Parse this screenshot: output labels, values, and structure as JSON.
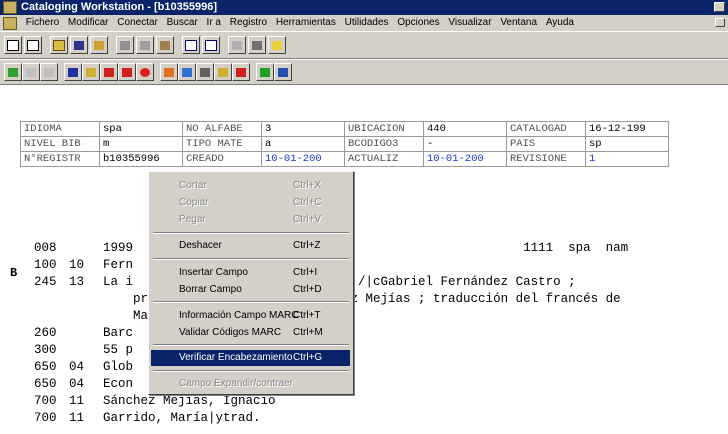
{
  "window": {
    "title": "Cataloging Workstation - [b10355996]",
    "app_icon": "app-icon"
  },
  "menu": [
    "Fichero",
    "Modificar",
    "Conectar",
    "Buscar",
    "Ir a",
    "Registro",
    "Herramientas",
    "Utilidades",
    "Opciones",
    "Visualizar",
    "Ventana",
    "Ayuda"
  ],
  "fixed_fields": {
    "row1": [
      "IDIOMA",
      "spa",
      "NO ALFABE",
      "3",
      "UBICACION",
      "440",
      "CATALOGAD",
      "16-12-199"
    ],
    "row2": [
      "NIVEL BIB",
      "m",
      "TIPO MATE",
      "a",
      "BCODIGO3",
      "-",
      "PAIS",
      "sp"
    ],
    "row3": [
      "N°REGISTR",
      "b10355996",
      "CREADO",
      "10-01-200",
      "ACTUALIZ",
      "10-01-200",
      "REVISIONE",
      "1"
    ]
  },
  "marc_marker": "B",
  "marc": [
    {
      "tag": "008",
      "ind": "",
      "text": "1999                                                    1111  spa  nam"
    },
    {
      "tag": "100",
      "ind": "10",
      "text": "Fern"
    },
    {
      "tag": "245",
      "ind": "13",
      "text": "La i                            l /|cGabriel Fernández Castro ;"
    },
    {
      "tag": "",
      "ind": "",
      "text": "    pról                         z Mejías ; traducción del francés de"
    },
    {
      "tag": "",
      "ind": "",
      "text": "    Marí"
    },
    {
      "tag": "260",
      "ind": "",
      "text": "Barc                       ,|1987"
    },
    {
      "tag": "300",
      "ind": "",
      "text": "55 p"
    },
    {
      "tag": "650",
      "ind": "04",
      "text": "Glob"
    },
    {
      "tag": "650",
      "ind": "04",
      "text": "Econ"
    },
    {
      "tag": "700",
      "ind": "11",
      "text": "Sánchez Mejías, Ignacio"
    },
    {
      "tag": "700",
      "ind": "11",
      "text": "Garrido, María|ytrad."
    }
  ],
  "context_menu": {
    "cut": {
      "label": "Cortar",
      "shortcut": "Ctrl+X"
    },
    "copy": {
      "label": "Copiar",
      "shortcut": "Ctrl+C"
    },
    "paste": {
      "label": "Pegar",
      "shortcut": "Ctrl+V"
    },
    "undo": {
      "label": "Deshacer",
      "shortcut": "Ctrl+Z"
    },
    "insert_field": {
      "label": "Insertar Campo",
      "shortcut": "Ctrl+I"
    },
    "delete_field": {
      "label": "Borrar Campo",
      "shortcut": "Ctrl+D"
    },
    "marc_info": {
      "label": "Información Campo MARC",
      "shortcut": "Ctrl+T"
    },
    "validate_marc": {
      "label": "Validar Códigos MARC",
      "shortcut": "Ctrl+M"
    },
    "verify_heading": {
      "label": "Verificar Encabezamiento",
      "shortcut": "Ctrl+G"
    },
    "expand_field": {
      "label": "Campo Expandir/contraer",
      "shortcut": ""
    }
  },
  "toolbar_icons": {
    "row1": [
      "new-icon",
      "template-icon",
      "open-icon",
      "save-icon",
      "edit-icon",
      "cut-icon",
      "copy-icon",
      "paste-icon",
      "window-icon",
      "split-icon",
      "preview-icon",
      "print-icon",
      "help-icon"
    ],
    "row2": [
      "prev-record-icon",
      "insert-icon",
      "delete-icon",
      "save-record-icon",
      "upload-icon",
      "cancel-icon",
      "close-icon",
      "stop-icon",
      "bookmark-icon",
      "diacritics-icon",
      "text-icon",
      "heading-icon",
      "check-icon",
      "fields-icon",
      "list-icon"
    ]
  },
  "colors": {
    "title_bar": "#0a246a",
    "chrome": "#d4d0c8",
    "highlight": "#0a246a",
    "link_blue": "#1a3ad0"
  }
}
